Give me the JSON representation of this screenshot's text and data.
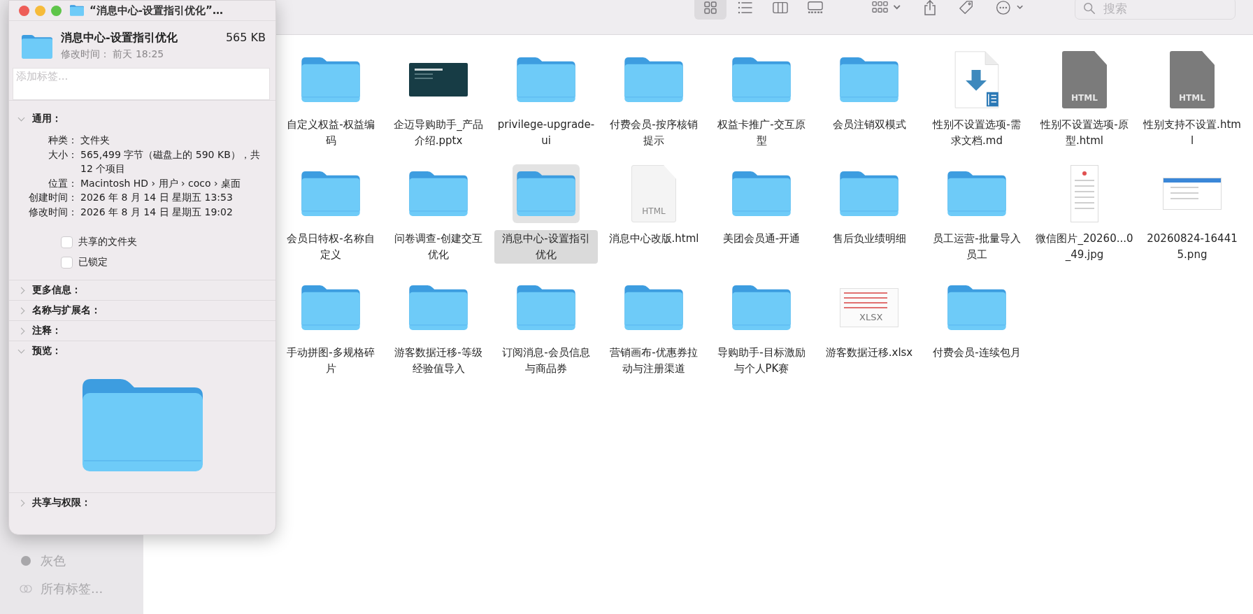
{
  "info_window": {
    "title": "“消息中心-设置指引优化”…",
    "name": "消息中心-设置指引优化",
    "size": "565 KB",
    "modified": "修改时间： 前天 18:25",
    "tags_placeholder": "添加标签...",
    "sections": [
      {
        "kind": "general",
        "label": "通用：",
        "expanded": true,
        "rows": [
          {
            "label": "种类：",
            "value": "文件夹"
          },
          {
            "label": "大小：",
            "value": "565,499 字节（磁盘上的 590 KB），共 12 个项目"
          },
          {
            "label": "位置：",
            "value": "Macintosh HD › 用户 › coco › 桌面"
          },
          {
            "label": "创建时间：",
            "value": "2026 年 8 月 14 日 星期五 13:53"
          },
          {
            "label": "修改时间：",
            "value": "2026 年 8 月 14 日 星期五 19:02"
          }
        ],
        "checkboxes": [
          {
            "label": "共享的文件夹",
            "checked": false
          },
          {
            "label": "已锁定",
            "checked": false
          }
        ]
      },
      {
        "kind": "plain",
        "label": "更多信息：",
        "expanded": false
      },
      {
        "kind": "plain",
        "label": "名称与扩展名：",
        "expanded": false
      },
      {
        "kind": "plain",
        "label": "注释：",
        "expanded": false
      },
      {
        "kind": "preview",
        "label": "预览：",
        "expanded": true
      },
      {
        "kind": "plain",
        "label": "共享与权限：",
        "expanded": false
      }
    ]
  },
  "toolbar": {
    "view_buttons": [
      {
        "kind": "icons",
        "selected": true
      },
      {
        "kind": "list",
        "selected": false
      },
      {
        "kind": "columns",
        "selected": false
      },
      {
        "kind": "gallery",
        "selected": false
      }
    ],
    "search": {
      "placeholder": "搜索"
    }
  },
  "sidebar": {
    "tags": [
      {
        "kind": "color",
        "label": "灰色",
        "color": "#a8a7aa"
      },
      {
        "kind": "all",
        "label": "所有标签..."
      }
    ]
  },
  "files": [
    {
      "kind": "folder",
      "name": "自定义权益-权益编码",
      "selected": false
    },
    {
      "kind": "slides",
      "name": "企迈导购助手_产品介绍.pptx",
      "selected": false
    },
    {
      "kind": "folder",
      "name": "privilege-upgrade-ui",
      "selected": false
    },
    {
      "kind": "folder",
      "name": "付费会员-按序核销提示",
      "selected": false
    },
    {
      "kind": "folder",
      "name": "权益卡推广-交互原型",
      "selected": false
    },
    {
      "kind": "folder",
      "name": "会员注销双模式",
      "selected": false
    },
    {
      "kind": "markdown",
      "name": "性别不设置选项-需求文档.md",
      "selected": false
    },
    {
      "kind": "html-dark",
      "name": "性别不设置选项-原型.html",
      "badge": "HTML",
      "selected": false
    },
    {
      "kind": "html-dark",
      "name": "性别支持不设置.html",
      "badge": "HTML",
      "selected": false
    },
    {
      "kind": "folder",
      "name": "会员日特权-名称自定义",
      "selected": false
    },
    {
      "kind": "folder",
      "name": "问卷调查-创建交互优化",
      "selected": false
    },
    {
      "kind": "folder",
      "name": "消息中心-设置指引优化",
      "selected": true
    },
    {
      "kind": "html",
      "name": "消息中心改版.html",
      "badge": "HTML",
      "selected": false
    },
    {
      "kind": "folder",
      "name": "美团会员通-开通",
      "selected": false
    },
    {
      "kind": "folder",
      "name": "售后负业绩明细",
      "selected": false
    },
    {
      "kind": "folder",
      "name": "员工运营-批量导入员工",
      "selected": false
    },
    {
      "kind": "phone-image",
      "name": "微信图片_20260...0_49.jpg",
      "selected": false
    },
    {
      "kind": "screenshot",
      "name": "20260824-164415.png",
      "selected": false
    },
    {
      "kind": "folder",
      "name": "手动拼图-多规格碎片",
      "selected": false
    },
    {
      "kind": "folder",
      "name": "游客数据迁移-等级经验值导入",
      "selected": false
    },
    {
      "kind": "folder",
      "name": "订阅消息-会员信息与商品券",
      "selected": false
    },
    {
      "kind": "folder",
      "name": "营销画布-优惠券拉动与注册渠道",
      "selected": false
    },
    {
      "kind": "folder",
      "name": "导购助手-目标激励与个人PK赛",
      "selected": false
    },
    {
      "kind": "spreadsheet",
      "name": "游客数据迁移.xlsx",
      "badge": "XLSX",
      "selected": false
    },
    {
      "kind": "folder",
      "name": "付费会员-连续包月",
      "selected": false
    }
  ]
}
